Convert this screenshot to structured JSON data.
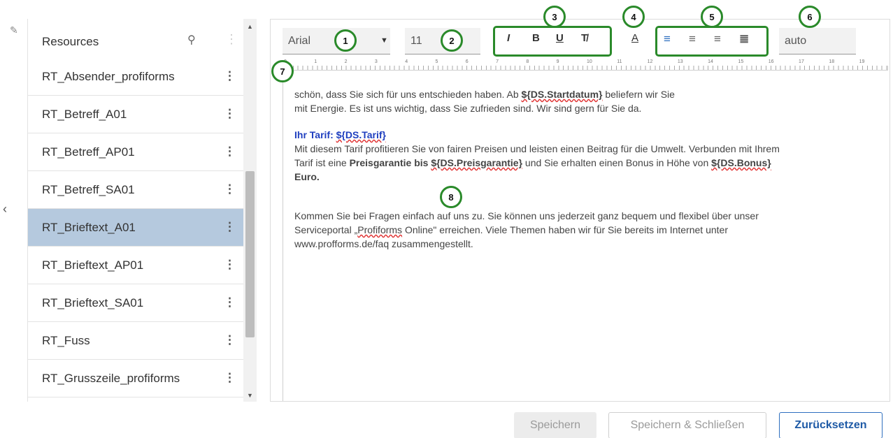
{
  "rail": {
    "pin_icon": "pin-icon",
    "collapse_icon": "chevron-left-icon",
    "collapse_glyph": "‹"
  },
  "panel": {
    "title": "Resources",
    "items": [
      {
        "label": "RT_Absender_profiforms"
      },
      {
        "label": "RT_Betreff_A01"
      },
      {
        "label": "RT_Betreff_AP01"
      },
      {
        "label": "RT_Betreff_SA01"
      },
      {
        "label": "RT_Brieftext_A01",
        "selected": true
      },
      {
        "label": "RT_Brieftext_AP01"
      },
      {
        "label": "RT_Brieftext_SA01"
      },
      {
        "label": "RT_Fuss"
      },
      {
        "label": "RT_Grusszeile_profiforms"
      }
    ]
  },
  "toolbar": {
    "font": "Arial",
    "size": "11",
    "line_height": "auto",
    "italic": "I",
    "bold": "B",
    "underline": "U",
    "clear_format": "T̸",
    "text_color": "A"
  },
  "markers": [
    "1",
    "2",
    "3",
    "4",
    "5",
    "6",
    "7",
    "8"
  ],
  "editor": {
    "p1_a": "schön, dass Sie sich für uns entschieden haben. Ab ",
    "p1_var": "${DS.Startdatum}",
    "p1_b": " beliefern wir Sie",
    "p1_c": "mit Energie. Es ist uns wichtig, dass Sie zufrieden sind. Wir sind gern für Sie da.",
    "tarif_label": "Ihr Tarif: ",
    "tarif_var": "${DS.Tarif}",
    "p2_a": "Mit diesem Tarif profitieren Sie von fairen Preisen und leisten einen Beitrag für die Umwelt. Verbunden mit Ihrem",
    "p2_b": "Tarif ist eine ",
    "p2_bold": "Preisgarantie bis ",
    "p2_var": "${DS.Preisgarantie}",
    "p2_c": " und Sie erhalten einen Bonus in Höhe von ",
    "p2_var2": "${DS.Bonus}",
    "p2_d": "Euro.",
    "p3_a": "Kommen Sie bei Fragen einfach auf uns zu. Sie können uns jederzeit ganz bequem und flexibel über unser",
    "p3_b": "Serviceportal „",
    "p3_link": "Profiforms",
    "p3_c": " Online\" erreichen. Viele Themen haben wir für Sie bereits im Internet unter",
    "p3_d": "www.profforms.de/faq zusammengestellt."
  },
  "ruler": [
    "0",
    "1",
    "2",
    "3",
    "4",
    "5",
    "6",
    "7",
    "8",
    "9",
    "10",
    "11",
    "12",
    "13",
    "14",
    "15",
    "16",
    "17",
    "18",
    "19"
  ],
  "footer": {
    "save": "Speichern",
    "save_close": "Speichern & Schließen",
    "reset": "Zurücksetzen"
  },
  "colors": {
    "accent": "#2f6fbf",
    "marker": "#2a8a2a",
    "selected": "#b5c9de"
  }
}
